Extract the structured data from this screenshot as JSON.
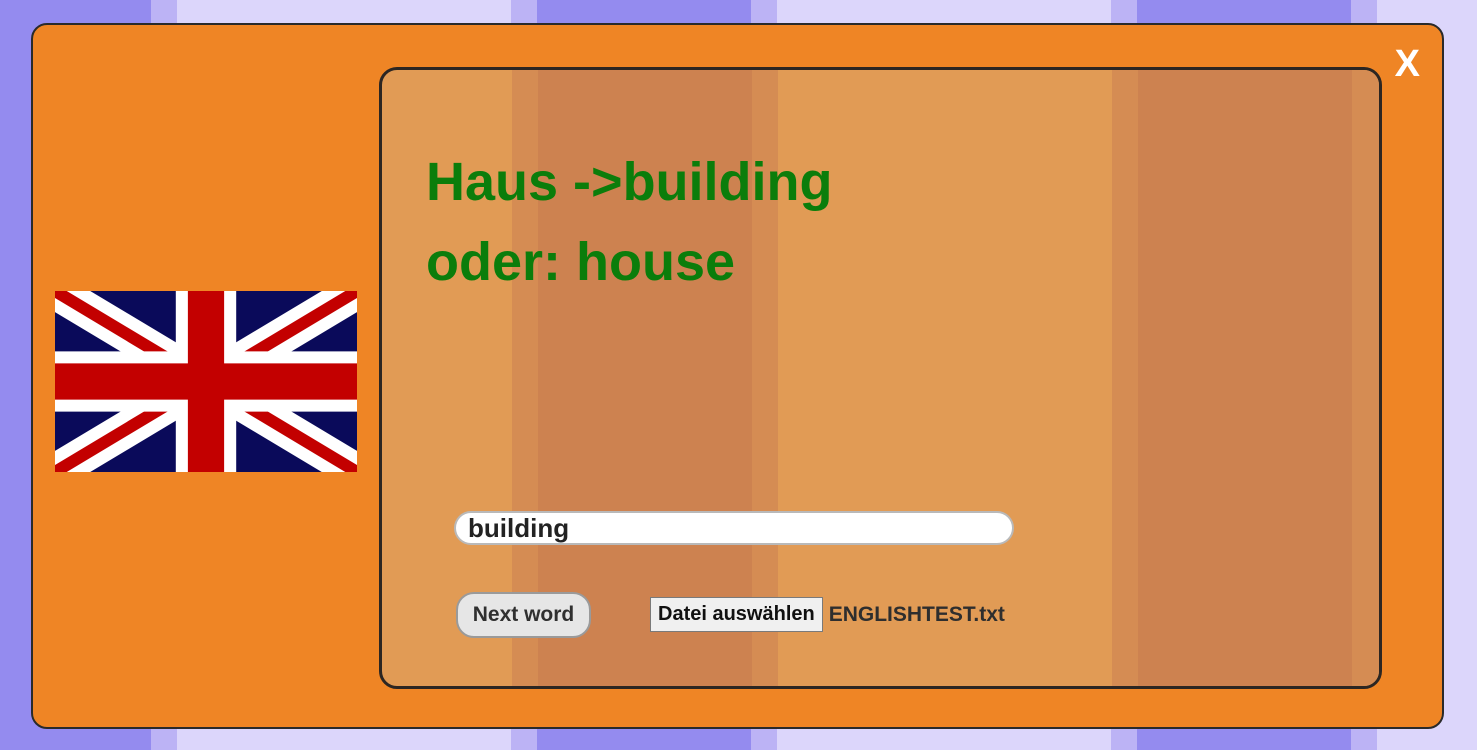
{
  "window": {
    "close_label": "X"
  },
  "flag": {
    "icon": "uk-flag-icon",
    "colors": {
      "blue": "#0a0a5a",
      "red": "#c30000",
      "white": "#ffffff"
    }
  },
  "quiz": {
    "question_line1": "Haus ->building",
    "question_line2": "oder: house",
    "answer_value": "building",
    "next_label": "Next word",
    "file_button_label": "Datei auswählen",
    "file_name": "ENGLISHTEST.txt"
  },
  "theme": {
    "panel": "#ef8525",
    "card": "#e19b55",
    "card_stripe": "#cd8250",
    "text_green": "#0b7d0b",
    "background": "#dcd6fb",
    "background_stripe": "#948bef"
  }
}
